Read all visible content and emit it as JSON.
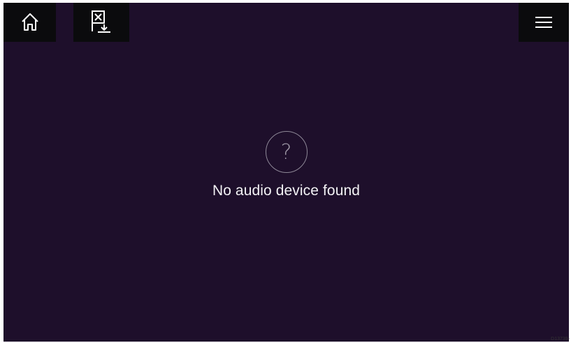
{
  "toolbar": {
    "home_icon": "home-icon",
    "waypoint_icon": "waypoint-mob-icon",
    "menu_icon": "hamburger-menu-icon"
  },
  "main": {
    "status_icon": "question-mark-icon",
    "status_glyph": "?",
    "message": "No audio device found"
  },
  "footer": {
    "doc_code": "D13739-"
  },
  "colors": {
    "background": "#1e0f2b",
    "toolbar_button": "#0b0b0d",
    "text": "#f2f1f4",
    "icon_outline": "#8e8897"
  }
}
